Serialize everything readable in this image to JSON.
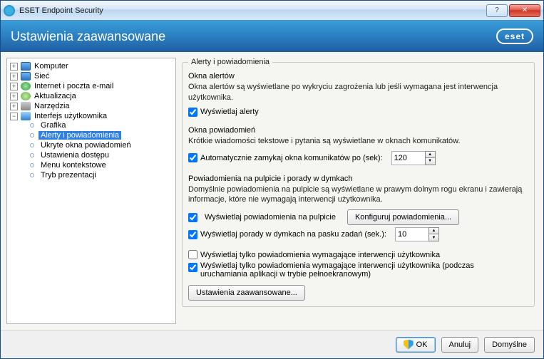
{
  "window": {
    "title": "ESET Endpoint Security"
  },
  "banner": {
    "title": "Ustawienia zaawansowane",
    "brand": "eset"
  },
  "tree": {
    "items": [
      {
        "label": "Komputer",
        "icon": "monitor"
      },
      {
        "label": "Sieć",
        "icon": "monitor"
      },
      {
        "label": "Internet i poczta e-mail",
        "icon": "globe"
      },
      {
        "label": "Aktualizacja",
        "icon": "refresh"
      },
      {
        "label": "Narzędzia",
        "icon": "tools"
      },
      {
        "label": "Interfejs użytkownika",
        "icon": "ui",
        "children": [
          {
            "label": "Grafika"
          },
          {
            "label": "Alerty i powiadomienia",
            "selected": true
          },
          {
            "label": "Ukryte okna powiadomień"
          },
          {
            "label": "Ustawienia dostępu"
          },
          {
            "label": "Menu kontekstowe"
          },
          {
            "label": "Tryb prezentacji"
          }
        ]
      }
    ]
  },
  "content": {
    "legend": "Alerty i powiadomienia",
    "alert_windows": {
      "title": "Okna alertów",
      "desc": "Okna alertów są wyświetlane po wykryciu zagrożenia lub jeśli wymagana jest interwencja użytkownika.",
      "cb_display_alerts": "Wyświetlaj alerty"
    },
    "notif_windows": {
      "title": "Okna powiadomień",
      "desc": "Krótkie wiadomości tekstowe i pytania są wyświetlane w oknach komunikatów.",
      "cb_autoclose": "Automatycznie zamykaj okna komunikatów po (sek):",
      "autoclose_value": "120"
    },
    "desktop": {
      "title": "Powiadomienia na pulpicie i porady w dymkach",
      "desc": "Domyślnie powiadomienia na pulpicie są wyświetlane w prawym dolnym rogu ekranu i zawierają informacje, które nie wymagają interwencji użytkownika.",
      "cb_desktop": "Wyświetlaj powiadomienia na pulpicie",
      "btn_configure": "Konfiguruj powiadomienia...",
      "cb_balloon": "Wyświetlaj porady w dymkach na pasku zadań (sek.):",
      "balloon_value": "10"
    },
    "extra": {
      "cb_only_intervention": "Wyświetlaj tylko powiadomienia wymagające interwencji użytkownika",
      "cb_only_intervention_fullscreen": "Wyświetlaj tylko powiadomienia wymagające interwencji użytkownika (podczas uruchamiania aplikacji w trybie pełnoekranowym)"
    },
    "btn_advanced": "Ustawienia zaawansowane..."
  },
  "footer": {
    "ok": "OK",
    "cancel": "Anuluj",
    "default": "Domyślne"
  }
}
